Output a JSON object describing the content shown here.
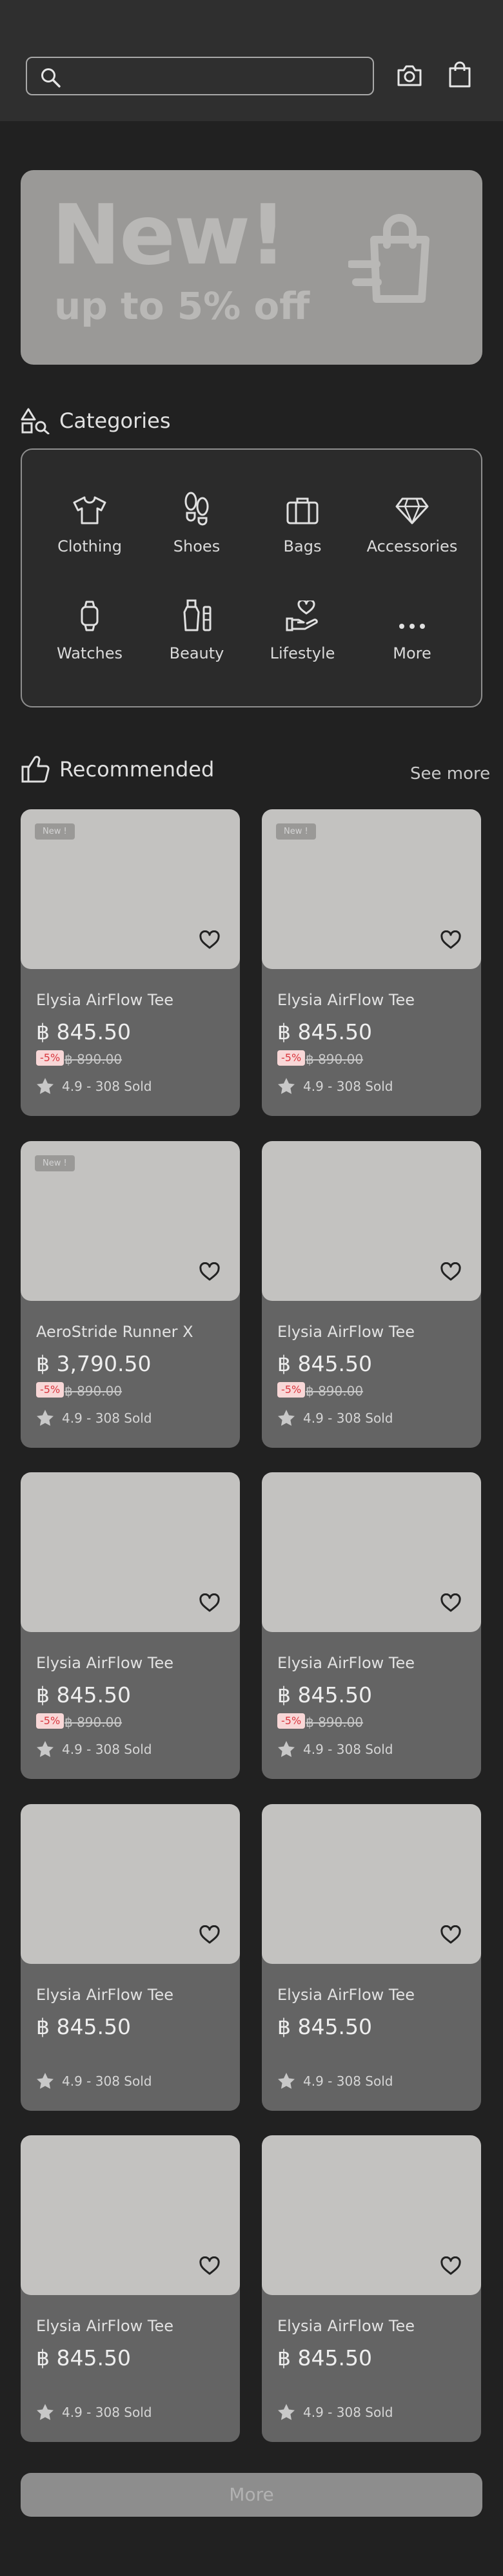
{
  "search": {
    "placeholder": ""
  },
  "banner": {
    "line1": "New!",
    "line2": "up to 5% off"
  },
  "categories": {
    "title": "Categories",
    "items": [
      {
        "label": "Clothing",
        "icon": "tshirt-icon"
      },
      {
        "label": "Shoes",
        "icon": "footprints-icon"
      },
      {
        "label": "Bags",
        "icon": "briefcase-icon"
      },
      {
        "label": "Accessories",
        "icon": "diamond-icon"
      },
      {
        "label": "Watches",
        "icon": "watch-icon"
      },
      {
        "label": "Beauty",
        "icon": "perfume-icon"
      },
      {
        "label": "Lifestyle",
        "icon": "hand-heart-icon"
      },
      {
        "label": "More",
        "icon": "more-dots-icon"
      }
    ]
  },
  "recommended": {
    "title": "Recommended",
    "see_more": "See more",
    "products": [
      {
        "badge": "New !",
        "name": "Elysia AirFlow Tee",
        "price": "฿ 845.50",
        "discount": "-5%",
        "old_price": "฿ 890.00",
        "rating": "4.9 - 308 Sold"
      },
      {
        "badge": "New !",
        "name": "Elysia AirFlow Tee",
        "price": "฿ 845.50",
        "discount": "-5%",
        "old_price": "฿ 890.00",
        "rating": "4.9 - 308 Sold"
      },
      {
        "badge": "New !",
        "name": "AeroStride Runner X",
        "price": "฿ 3,790.50",
        "discount": "-5%",
        "old_price": "฿ 890.00",
        "rating": "4.9 - 308 Sold"
      },
      {
        "badge": "",
        "name": "Elysia AirFlow Tee",
        "price": "฿ 845.50",
        "discount": "-5%",
        "old_price": "฿ 890.00",
        "rating": "4.9 - 308 Sold"
      },
      {
        "badge": "",
        "name": "Elysia AirFlow Tee",
        "price": "฿ 845.50",
        "discount": "-5%",
        "old_price": "฿ 890.00",
        "rating": "4.9 - 308 Sold"
      },
      {
        "badge": "",
        "name": "Elysia AirFlow Tee",
        "price": "฿ 845.50",
        "discount": "-5%",
        "old_price": "฿ 890.00",
        "rating": "4.9 - 308 Sold"
      },
      {
        "badge": "",
        "name": "Elysia AirFlow Tee",
        "price": "฿ 845.50",
        "discount": "",
        "old_price": "",
        "rating": "4.9 - 308 Sold"
      },
      {
        "badge": "",
        "name": "Elysia AirFlow Tee",
        "price": "฿ 845.50",
        "discount": "",
        "old_price": "",
        "rating": "4.9 - 308 Sold"
      },
      {
        "badge": "",
        "name": "Elysia AirFlow Tee",
        "price": "฿ 845.50",
        "discount": "",
        "old_price": "",
        "rating": "4.9 - 308 Sold"
      },
      {
        "badge": "",
        "name": "Elysia AirFlow Tee",
        "price": "฿ 845.50",
        "discount": "",
        "old_price": "",
        "rating": "4.9 - 308 Sold"
      }
    ]
  },
  "more_button": {
    "label": "More"
  }
}
